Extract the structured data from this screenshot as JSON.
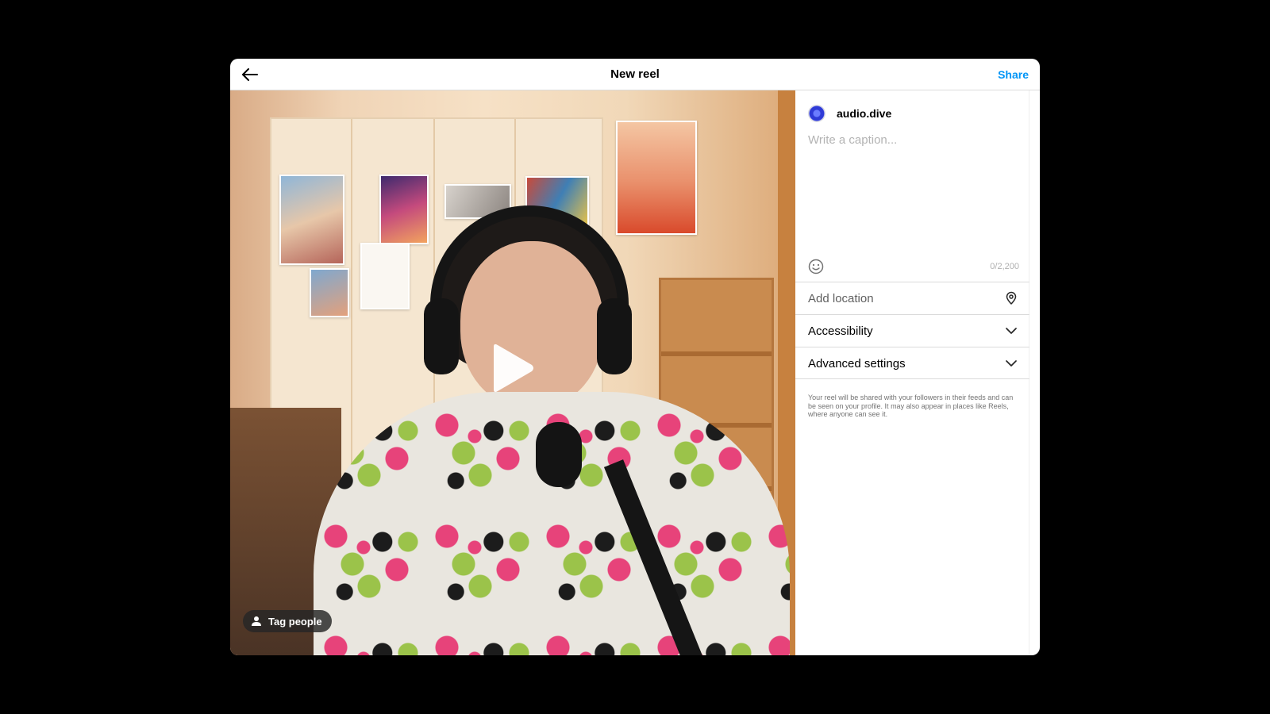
{
  "header": {
    "title": "New reel",
    "share_label": "Share"
  },
  "video": {
    "tag_people_label": "Tag people"
  },
  "panel": {
    "username": "audio.dive",
    "caption_placeholder": "Write a caption...",
    "caption_value": "",
    "char_count": "0/2,200",
    "add_location_label": "Add location",
    "accessibility_label": "Accessibility",
    "advanced_settings_label": "Advanced settings",
    "notice": "Your reel will be shared with your followers in their feeds and can be seen on your profile. It may also appear in places like Reels, where anyone can see it."
  },
  "icons": {
    "back": "arrow-left-icon",
    "play": "play-icon",
    "person": "person-icon",
    "emoji": "smiley-icon",
    "location": "map-pin-icon",
    "chevron": "chevron-down-icon"
  },
  "colors": {
    "accent": "#0095f6",
    "background": "#000000",
    "panel": "#ffffff",
    "border": "#dbdbdb"
  }
}
